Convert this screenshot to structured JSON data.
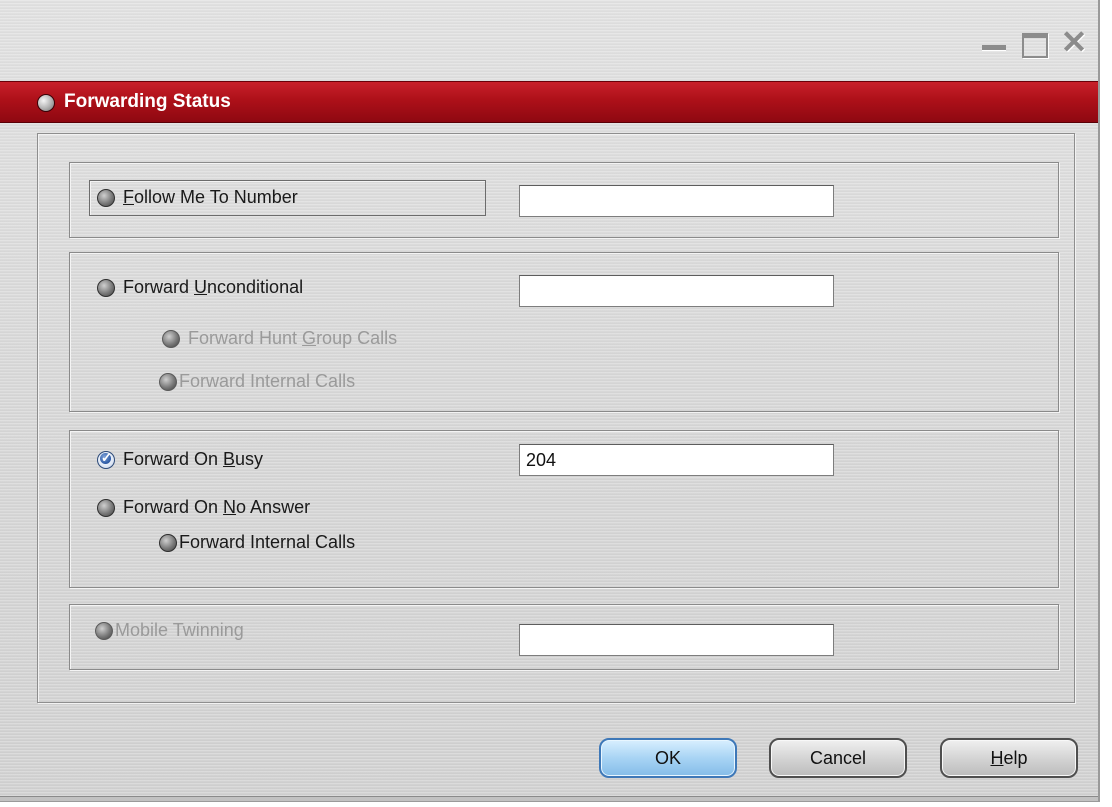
{
  "window": {
    "title": "Forwarding Status",
    "controls": [
      "minimize-icon",
      "maximize-icon",
      "close-icon"
    ]
  },
  "follow_me": {
    "label_pre": "",
    "label_ul": "F",
    "label_post": "ollow Me To Number",
    "value": ""
  },
  "unconditional": {
    "label_pre": "Forward ",
    "label_ul": "U",
    "label_post": "nconditional",
    "value": "",
    "hunt_pre": "Forward Hunt ",
    "hunt_ul": "G",
    "hunt_post": "roup Calls",
    "internal_label": "Forward Internal Calls"
  },
  "busy": {
    "label_pre": "Forward On ",
    "label_ul": "B",
    "label_post": "usy",
    "value": "204",
    "checked": true
  },
  "no_answer": {
    "label_pre": "Forward On ",
    "label_ul": "N",
    "label_post": "o Answer",
    "internal_label": "Forward Internal Calls"
  },
  "mobile": {
    "label": "Mobile Twinning",
    "value": ""
  },
  "buttons": {
    "ok": "OK",
    "cancel": "Cancel",
    "help_ul": "H",
    "help_post": "elp"
  },
  "colors": {
    "title_band": "#ad1019",
    "ok_button": "#a8d4f4",
    "checked_radio": "#2c5aa6"
  }
}
